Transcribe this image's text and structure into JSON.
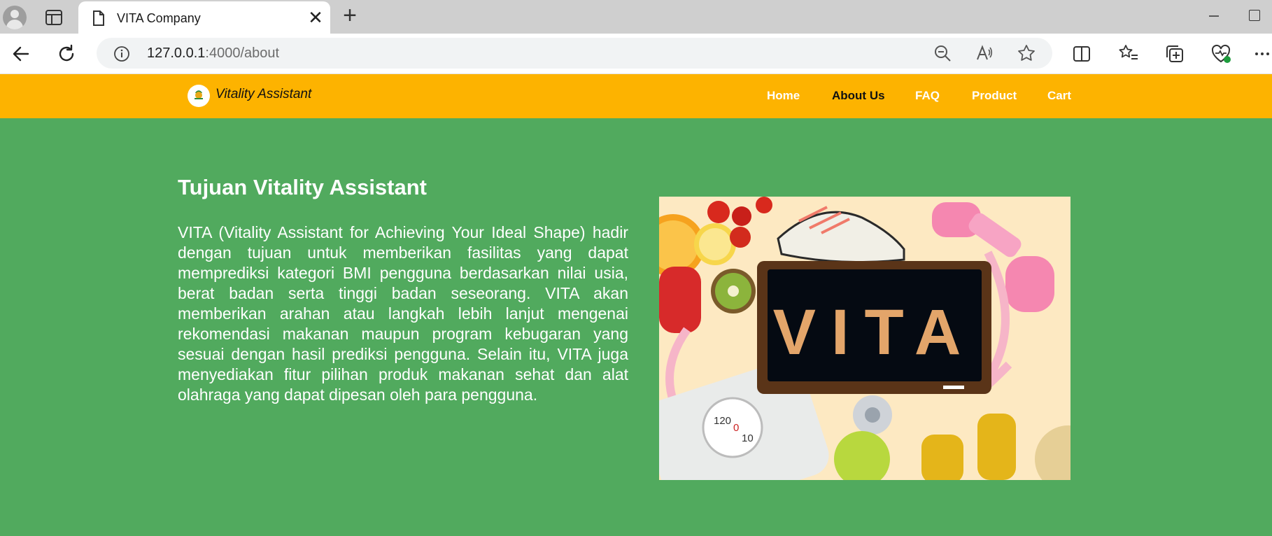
{
  "browser": {
    "tab_title": "VITA Company",
    "close_glyph": "✕",
    "newtab_glyph": "+",
    "url_host": "127.0.0.1",
    "url_path": ":4000/about"
  },
  "nav": {
    "brand": "Vitality Assistant",
    "links": [
      "Home",
      "About Us",
      "FAQ",
      "Product",
      "Cart"
    ],
    "active": "About Us"
  },
  "main": {
    "heading": "Tujuan Vitality Assistant",
    "paragraph": "VITA (Vitality Assistant for Achieving Your Ideal Shape) hadir dengan tujuan untuk memberikan fasilitas yang dapat memprediksi kategori BMI pengguna berdasarkan nilai usia, berat badan serta tinggi badan seseorang. VITA akan memberikan arahan atau langkah lebih lanjut mengenai rekomendasi makanan maupun program kebugaran yang sesuai dengan hasil prediksi pengguna. Selain itu, VITA juga menyediakan fitur pilihan produk makanan sehat dan alat olahraga yang dapat dipesan oleh para pengguna.",
    "hero_word": "VITA",
    "scale_numbers": [
      "120",
      "0",
      "10"
    ]
  },
  "colors": {
    "navbar": "#fdb300",
    "page_bg": "#51aa5e",
    "hero_bg": "#fde9c2"
  }
}
